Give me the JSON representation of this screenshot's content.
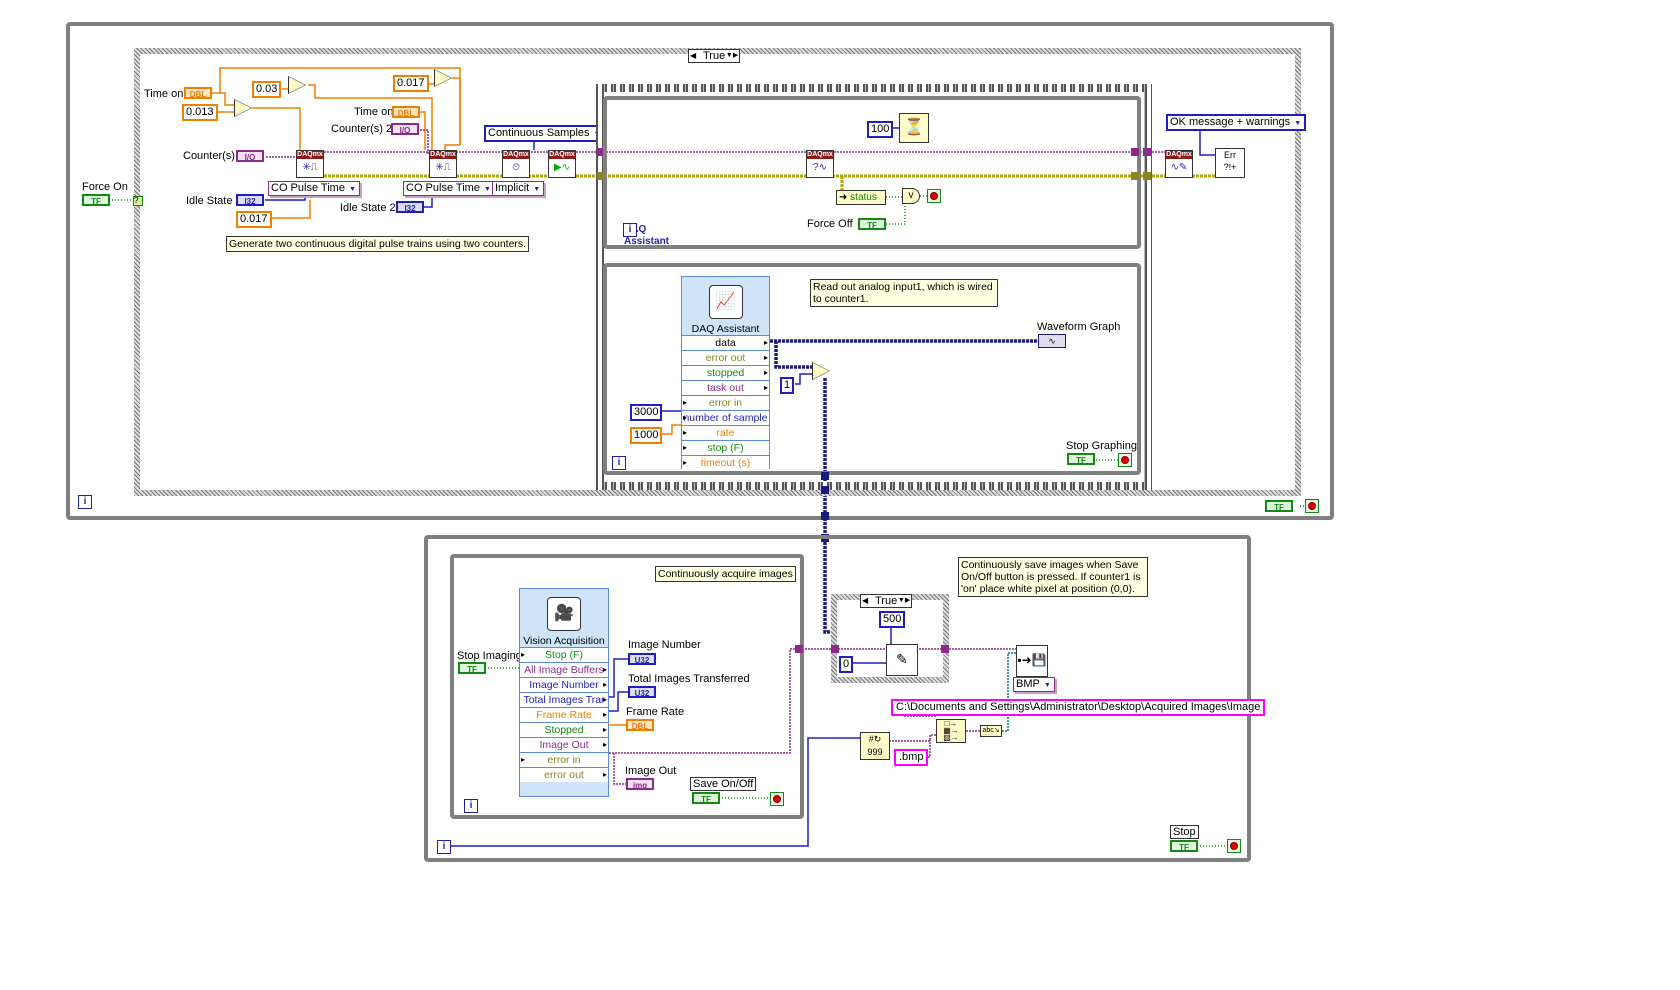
{
  "top_loop": {
    "iteration": "i",
    "case_selector": "True",
    "force_on": {
      "label": "Force On",
      "terminal": "TF"
    },
    "time_on_1": {
      "label": "Time on",
      "terminal": "DBL"
    },
    "time_on_2": {
      "label": "Time on",
      "terminal": "DBL"
    },
    "counters_1": {
      "label": "Counter(s)",
      "terminal": "I/O"
    },
    "counters_2": {
      "label": "Counter(s) 2",
      "terminal": "I/O"
    },
    "idle_state_1": {
      "label": "Idle State",
      "terminal": "I32"
    },
    "idle_state_2": {
      "label": "Idle State 2",
      "terminal": "I32"
    },
    "constants": {
      "c1": "0.013",
      "c2": "0.03",
      "c3": "0.017",
      "c4": "0.017"
    },
    "rings": {
      "co1": "CO Pulse Time",
      "co2": "CO Pulse Time",
      "timing": "Implicit",
      "sample_mode": "Continuous Samples",
      "error_dialog": "OK message + warnings"
    },
    "daqmx_label": "DAQmx",
    "comment_pulse": "Generate two continuous digital pulse trains using two counters.",
    "wait_ms": "100",
    "status_label": "status",
    "force_off": {
      "label": "Force Off",
      "terminal": "TF"
    },
    "daq_assistant": {
      "title": "DAQ Assistant",
      "outputs": [
        "data",
        "error out",
        "stopped",
        "task out"
      ],
      "inputs": [
        "error in",
        "number of sample",
        "rate",
        "stop (F)",
        "timeout (s)"
      ],
      "number_of_samples": "3000",
      "rate": "1000"
    },
    "comment_analog": "Read out analog input1, which is wired to counter1.",
    "compare_constant": "1",
    "waveform_graph": "Waveform Graph",
    "stop_graphing": {
      "label": "Stop Graphing",
      "terminal": "TF"
    },
    "stop_terminal": "TF"
  },
  "bottom_loop": {
    "iteration": "i",
    "comment_acquire": "Continuously acquire images",
    "stop_imaging": {
      "label": "Stop Imaging",
      "terminal": "TF"
    },
    "vision_acquisition": {
      "title": "Vision Acquisition",
      "rows": [
        "Stop (F)",
        "All Image Buffers",
        "Image Number",
        "Total Images Trar",
        "Frame Rate",
        "Stopped",
        "Image Out",
        "error in",
        "error out"
      ]
    },
    "image_number": {
      "label": "Image Number",
      "terminal": "U32"
    },
    "total_images": {
      "label": "Total Images Transferred",
      "terminal": "U32"
    },
    "frame_rate": {
      "label": "Frame Rate",
      "terminal": "DBL"
    },
    "image_out": {
      "label": "Image Out",
      "terminal": "img"
    },
    "save_on_off": {
      "label": "Save On/Off",
      "terminal": "TF"
    },
    "case_selector": "True",
    "pixel_value": "500",
    "pixel_index": "0",
    "comment_save": "Continuously save images when Save On/Off button is pressed.  If counter1 is 'on' place white pixel at position (0,0).",
    "file_format": "BMP",
    "path": "C:\\Documents and Settings\\Administrator\\Desktop\\Acquired Images\\Image",
    "extension": ".bmp",
    "stop": {
      "label": "Stop",
      "terminal": "TF"
    }
  },
  "colors": {
    "dbl_wire": "#f07f00",
    "int_wire": "#1f1fc0",
    "task_wire": "#8a2a8a",
    "error_wire": "#b0a800",
    "bool_wire": "#128a12",
    "string_wire": "#ff00ff",
    "structure": "#808080"
  }
}
